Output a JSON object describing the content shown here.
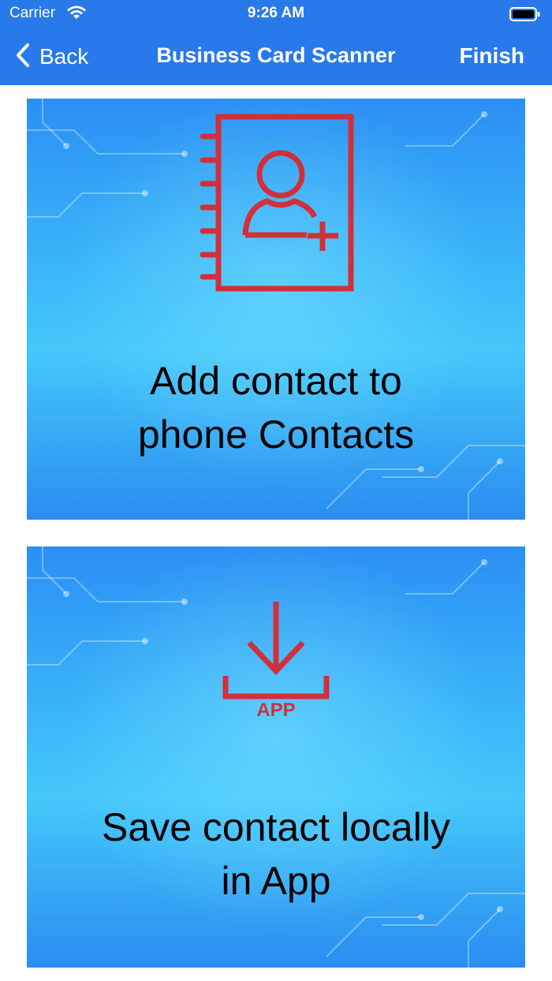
{
  "status_bar": {
    "carrier": "Carrier",
    "time": "9:26 AM"
  },
  "nav": {
    "back_label": "Back",
    "title": "Business Card Scanner",
    "finish_label": "Finish"
  },
  "cards": [
    {
      "line1": "Add contact to",
      "line2": "phone Contacts",
      "icon": "contact-book-add-icon"
    },
    {
      "line1": "Save contact locally",
      "line2": "in App",
      "icon": "download-app-icon",
      "icon_label": "APP"
    }
  ],
  "colors": {
    "header": "#2879ea",
    "icon_red": "#d32f3a",
    "card_blue": "#3bb6f9"
  }
}
